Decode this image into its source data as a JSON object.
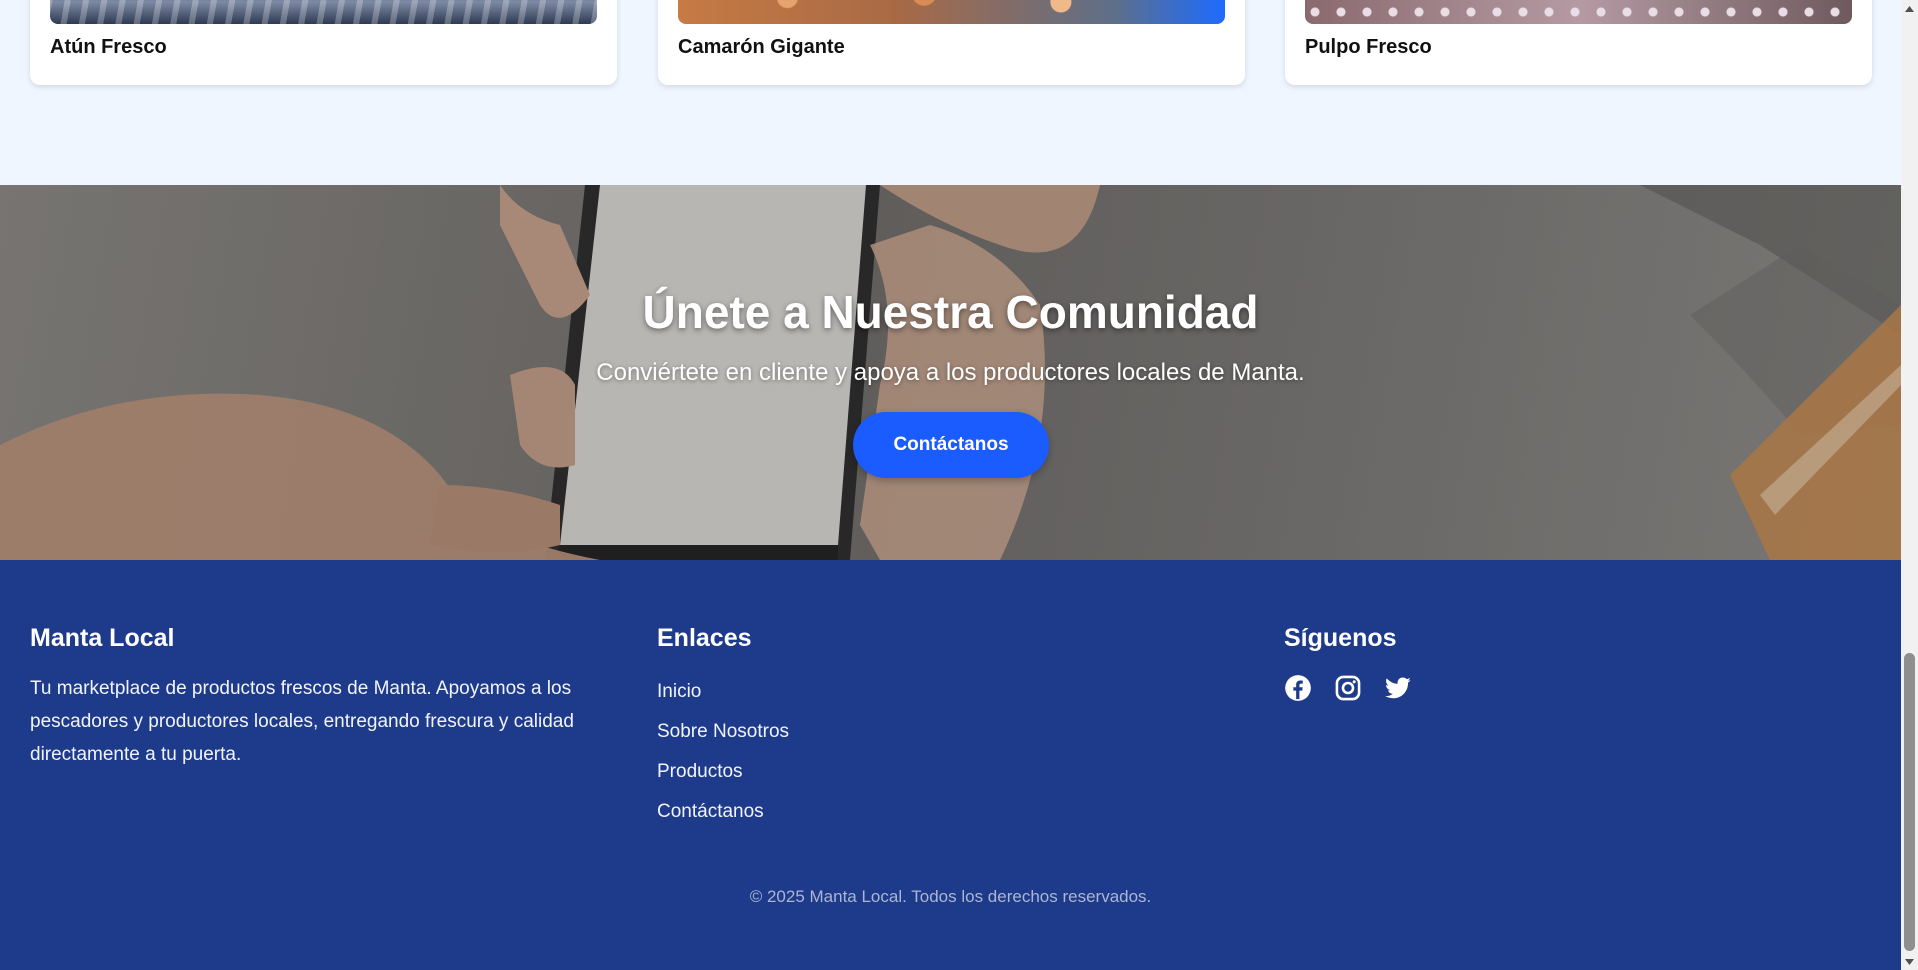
{
  "products": {
    "cards": [
      {
        "name": "Atún Fresco"
      },
      {
        "name": "Camarón Gigante"
      },
      {
        "name": "Pulpo Fresco"
      }
    ]
  },
  "banner": {
    "title": "Únete a Nuestra Comunidad",
    "subtitle": "Conviértete en cliente y apoya a los productores locales de Manta.",
    "cta_label": "Contáctanos"
  },
  "footer": {
    "brand": {
      "title": "Manta Local",
      "description": "Tu marketplace de productos frescos de Manta. Apoyamos a los pescadores y productores locales, entregando frescura y calidad directamente a tu puerta."
    },
    "links": {
      "title": "Enlaces",
      "items": [
        "Inicio",
        "Sobre Nosotros",
        "Productos",
        "Contáctanos"
      ]
    },
    "social": {
      "title": "Síguenos",
      "icons": [
        "facebook-icon",
        "instagram-icon",
        "twitter-icon"
      ]
    },
    "copyright": "© 2025 Manta Local. Todos los derechos reservados."
  },
  "colors": {
    "accent": "#1a5cff",
    "footer_bg": "#1e3a8a",
    "section_bg": "#eff6ff"
  }
}
